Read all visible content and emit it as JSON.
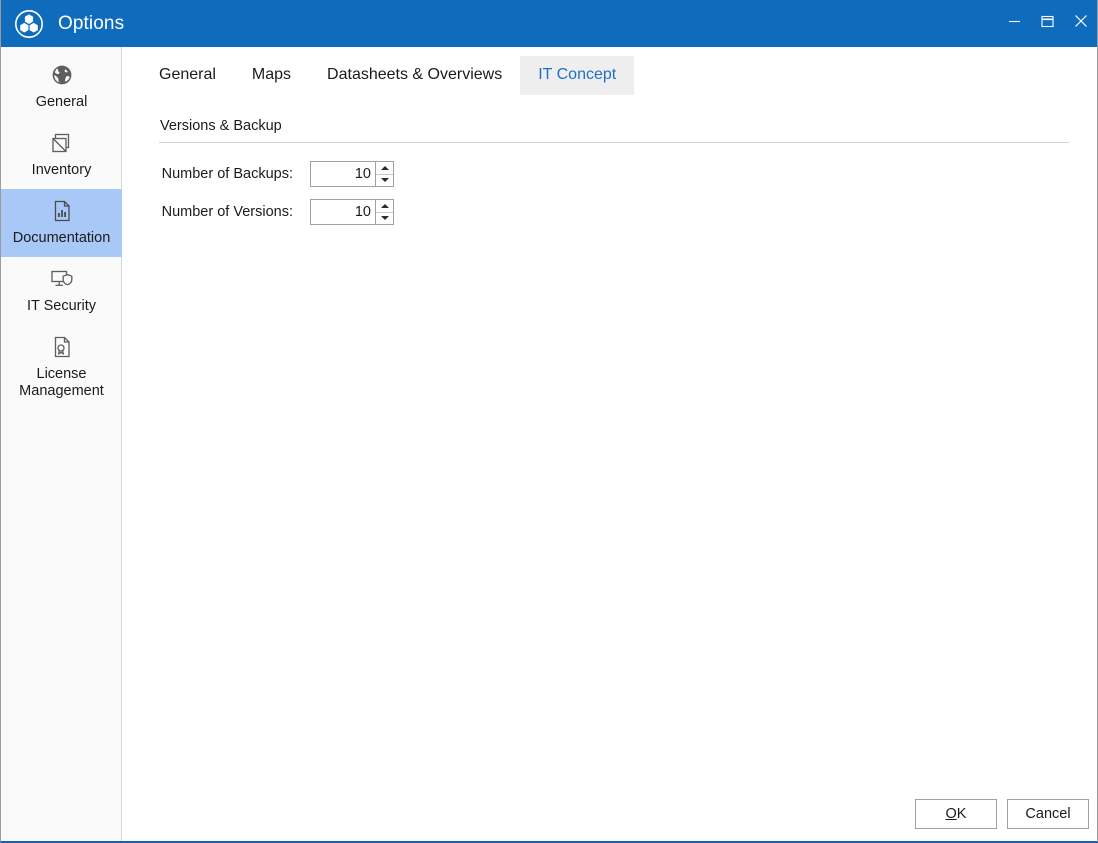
{
  "window": {
    "title": "Options",
    "logo_icon": "three-hexagons-circle-logo",
    "accent_color": "#0f6cbd",
    "selection_color": "#a8c8f8",
    "controls": [
      {
        "name": "minimize",
        "icon": "minimize-icon"
      },
      {
        "name": "maximize",
        "icon": "maximize-restore-icon"
      },
      {
        "name": "close",
        "icon": "close-icon"
      }
    ]
  },
  "sidebar": {
    "items": [
      {
        "label": "General",
        "icon": "globe-icon",
        "selected": false
      },
      {
        "label": "Inventory",
        "icon": "stacked-boxes-icon",
        "selected": false
      },
      {
        "label": "Documentation",
        "icon": "document-chart-icon",
        "selected": true
      },
      {
        "label": "IT Security",
        "icon": "monitor-shield-icon",
        "selected": false
      },
      {
        "label": "License\nManagement",
        "icon": "document-certificate-icon",
        "selected": false
      }
    ]
  },
  "tabs": [
    {
      "label": "General",
      "active": false
    },
    {
      "label": "Maps",
      "active": false
    },
    {
      "label": "Datasheets & Overviews",
      "active": false
    },
    {
      "label": "IT Concept",
      "active": true
    }
  ],
  "form": {
    "group_title": "Versions & Backup",
    "fields": [
      {
        "label": "Number of Backups:",
        "value": "10",
        "placeholder": ""
      },
      {
        "label": "Number of Versions:",
        "value": "10",
        "placeholder": ""
      }
    ]
  },
  "footer": {
    "ok_accel": "O",
    "ok_rest": "K",
    "cancel_label": "Cancel"
  }
}
